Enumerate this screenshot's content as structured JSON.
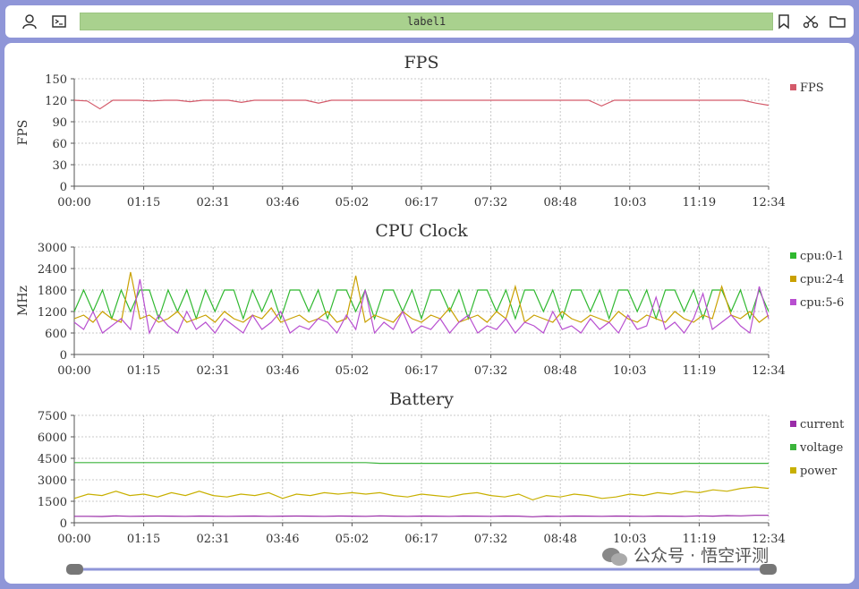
{
  "toolbar": {
    "label": "label1",
    "icons": [
      "user-icon",
      "terminal-icon",
      "bookmark-icon",
      "scissors-icon",
      "folder-icon"
    ]
  },
  "watermark": "公众号 · 悟空评测",
  "colors": {
    "fps": "#d45a6a",
    "cpu01": "#2fb82f",
    "cpu24": "#c9a000",
    "cpu56": "#b84fd0",
    "current": "#9a2ca8",
    "voltage": "#3bb43b",
    "power": "#c8b000"
  },
  "chart_data": [
    {
      "type": "line",
      "title": "FPS",
      "ylabel": "FPS",
      "ylim": [
        0,
        150
      ],
      "yticks": [
        "0",
        "30",
        "60",
        "90",
        "120",
        "150"
      ],
      "xticks": [
        "00:00",
        "01:15",
        "02:31",
        "03:46",
        "05:02",
        "06:17",
        "07:32",
        "08:48",
        "10:03",
        "11:19",
        "12:34"
      ],
      "legend": "right",
      "grid": true,
      "series": [
        {
          "name": "FPS",
          "values": [
            120,
            119,
            108,
            120,
            120,
            120,
            119,
            120,
            120,
            118,
            120,
            120,
            120,
            117,
            120,
            120,
            120,
            120,
            120,
            116,
            120,
            120,
            120,
            120,
            120,
            120,
            120,
            120,
            120,
            120,
            120,
            120,
            120,
            120,
            120,
            120,
            120,
            120,
            120,
            120,
            120,
            112,
            120,
            120,
            120,
            120,
            120,
            120,
            120,
            120,
            120,
            120,
            120,
            116,
            113
          ]
        }
      ]
    },
    {
      "type": "line",
      "title": "CPU Clock",
      "ylabel": "MHz",
      "ylim": [
        0,
        3000
      ],
      "yticks": [
        "0",
        "600",
        "1200",
        "1800",
        "2400",
        "3000"
      ],
      "xticks": [
        "00:00",
        "01:15",
        "02:31",
        "03:46",
        "05:02",
        "06:17",
        "07:32",
        "08:48",
        "10:03",
        "11:19",
        "12:34"
      ],
      "legend": "right",
      "grid": true,
      "series": [
        {
          "name": "cpu:0-1",
          "values": [
            1200,
            1800,
            1200,
            1800,
            1000,
            1800,
            1200,
            1800,
            1800,
            1000,
            1800,
            1200,
            1800,
            1000,
            1800,
            1200,
            1800,
            1800,
            1000,
            1800,
            1200,
            1800,
            1000,
            1800,
            1800,
            1200,
            1800,
            1000,
            1800,
            1800,
            1200,
            1800,
            1000,
            1800,
            1800,
            1200,
            1800,
            1000,
            1800,
            1800,
            1200,
            1800,
            1000,
            1800,
            1800,
            1200,
            1800,
            1000,
            1800,
            1800,
            1200,
            1800,
            1000,
            1800,
            1800,
            1200,
            1800,
            1000,
            1800,
            1800,
            1200,
            1800,
            1000,
            1800,
            1800,
            1200,
            1800,
            1000,
            1800,
            1800,
            1200,
            1800,
            1000,
            1800,
            1200
          ]
        },
        {
          "name": "cpu:2-4",
          "values": [
            1000,
            1100,
            900,
            1200,
            1000,
            900,
            2300,
            1000,
            1100,
            900,
            1000,
            1200,
            900,
            1000,
            1100,
            900,
            1200,
            1000,
            900,
            1100,
            1000,
            1300,
            900,
            1000,
            1100,
            900,
            1000,
            1200,
            900,
            1000,
            2200,
            900,
            1100,
            1000,
            900,
            1200,
            1000,
            900,
            1100,
            1000,
            1300,
            900,
            1000,
            1100,
            900,
            1200,
            1000,
            1900,
            900,
            1100,
            1000,
            900,
            1200,
            1000,
            900,
            1100,
            1000,
            900,
            1200,
            1000,
            900,
            1100,
            1000,
            900,
            1200,
            1000,
            900,
            1100,
            1000,
            1900,
            1100,
            1000,
            1200,
            900,
            1100
          ]
        },
        {
          "name": "cpu:5-6",
          "values": [
            900,
            700,
            1200,
            600,
            800,
            1000,
            700,
            2100,
            600,
            1100,
            800,
            600,
            1200,
            700,
            900,
            600,
            1000,
            800,
            600,
            1100,
            700,
            900,
            1200,
            600,
            800,
            700,
            1000,
            900,
            600,
            1100,
            700,
            1800,
            600,
            900,
            700,
            1200,
            600,
            800,
            700,
            1000,
            600,
            900,
            1100,
            600,
            800,
            700,
            1000,
            600,
            900,
            800,
            600,
            1200,
            700,
            800,
            600,
            1000,
            700,
            900,
            600,
            1100,
            700,
            800,
            1600,
            700,
            900,
            600,
            1000,
            1700,
            700,
            900,
            1100,
            800,
            600,
            1900,
            1000
          ]
        }
      ]
    },
    {
      "type": "line",
      "title": "Battery",
      "ylabel": "",
      "ylim": [
        0,
        7500
      ],
      "yticks": [
        "0",
        "1500",
        "3000",
        "4500",
        "6000",
        "7500"
      ],
      "xticks": [
        "00:00",
        "01:15",
        "02:31",
        "03:46",
        "05:02",
        "06:17",
        "07:32",
        "08:48",
        "10:03",
        "11:19",
        "12:34"
      ],
      "legend": "right",
      "grid": true,
      "series": [
        {
          "name": "current",
          "values": [
            450,
            450,
            440,
            480,
            450,
            460,
            470,
            460,
            450,
            470,
            460,
            450,
            460,
            470,
            450,
            460,
            470,
            460,
            450,
            470,
            460,
            450,
            480,
            460,
            450,
            470,
            460,
            450,
            470,
            460,
            450,
            470,
            460,
            420,
            460,
            450,
            470,
            460,
            450,
            470,
            460,
            450,
            470,
            460,
            450,
            480,
            460,
            500,
            480,
            520,
            520
          ]
        },
        {
          "name": "voltage",
          "values": [
            4200,
            4200,
            4200,
            4200,
            4200,
            4200,
            4200,
            4200,
            4200,
            4200,
            4200,
            4200,
            4200,
            4200,
            4200,
            4200,
            4200,
            4200,
            4200,
            4200,
            4200,
            4200,
            4150,
            4150,
            4150,
            4150,
            4150,
            4150,
            4150,
            4150,
            4150,
            4150,
            4150,
            4150,
            4150,
            4150,
            4150,
            4150,
            4150,
            4150,
            4150,
            4150,
            4150,
            4150,
            4150,
            4150,
            4150,
            4150,
            4150,
            4150,
            4150
          ]
        },
        {
          "name": "power",
          "values": [
            1700,
            2000,
            1900,
            2200,
            1900,
            2000,
            1800,
            2100,
            1900,
            2200,
            1900,
            1800,
            2000,
            1900,
            2100,
            1700,
            2000,
            1900,
            2100,
            2000,
            2100,
            2000,
            2100,
            1900,
            1800,
            2000,
            1900,
            1800,
            2000,
            2100,
            1900,
            1800,
            2000,
            1600,
            1900,
            1800,
            2000,
            1900,
            1700,
            1800,
            2000,
            1900,
            2100,
            2000,
            2200,
            2100,
            2300,
            2200,
            2400,
            2500,
            2400
          ]
        }
      ]
    }
  ]
}
